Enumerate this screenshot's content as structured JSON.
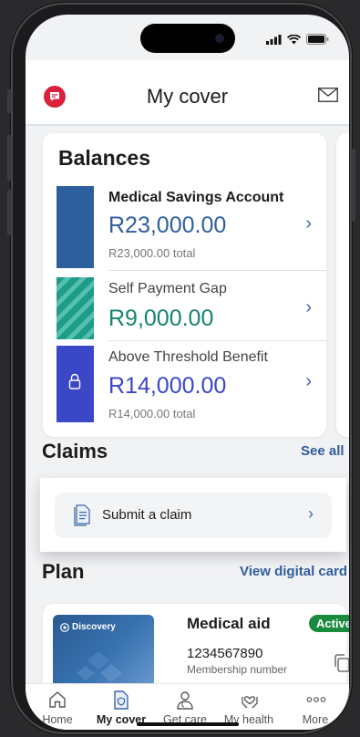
{
  "header": {
    "title": "My cover"
  },
  "balances": {
    "title": "Balances",
    "items": [
      {
        "name": "Medical Savings Account",
        "amount": "R23,000.00",
        "total": "R23,000.00 total",
        "color": "#2d5f9e",
        "name_bold": true
      },
      {
        "name": "Self Payment Gap",
        "amount": "R9,000.00",
        "total": "",
        "color": "#1f9b8a",
        "name_bold": false
      },
      {
        "name": "Above Threshold Benefit",
        "amount": "R14,000.00",
        "total": "R14,000.00 total",
        "color": "#3a47c6",
        "name_bold": false
      }
    ]
  },
  "claims": {
    "title": "Claims",
    "see_all": "See all",
    "submit_label": "Submit a claim"
  },
  "plan": {
    "title": "Plan",
    "view_card": "View digital card",
    "card_brand": "Discovery",
    "card_title": "Medical aid",
    "status": "Active",
    "membership_number": "1234567890",
    "membership_label": "Membership number"
  },
  "tabs": [
    {
      "label": "Home",
      "icon": "home-icon"
    },
    {
      "label": "My cover",
      "icon": "document-shield-icon",
      "active": true
    },
    {
      "label": "Get care",
      "icon": "doctor-icon"
    },
    {
      "label": "My health",
      "icon": "heart-hands-icon"
    },
    {
      "label": "More",
      "icon": "more-dots-icon"
    }
  ]
}
